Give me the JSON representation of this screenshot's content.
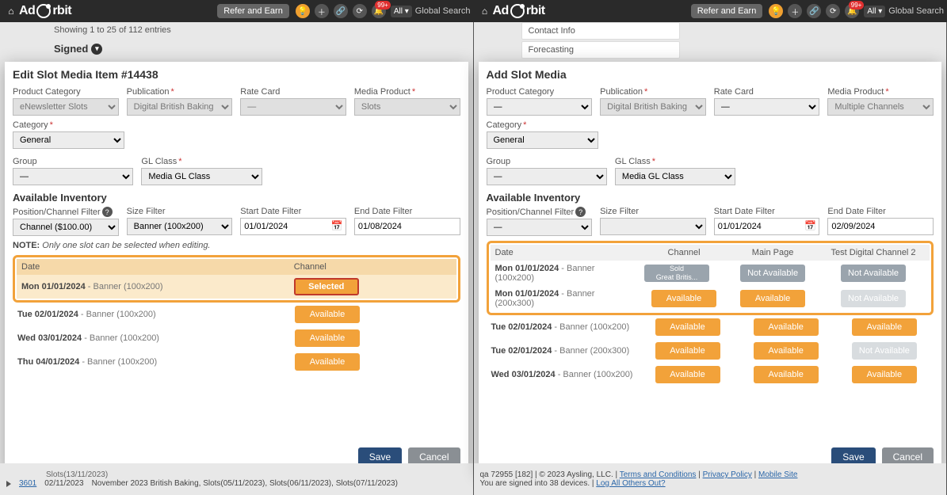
{
  "topbar": {
    "brand1": "Ad",
    "brand2": "rbit",
    "refer": "Refer and Earn",
    "notif": "99+",
    "all": "All",
    "global_search": "Global Search"
  },
  "left": {
    "bg_entries": "Showing 1 to 25 of 112 entries",
    "signed_heading": "Signed",
    "modal_title": "Edit Slot Media Item #14438",
    "labels": {
      "product_category": "Product Category",
      "publication": "Publication",
      "rate_card": "Rate Card",
      "media_product": "Media Product",
      "category": "Category",
      "group": "Group",
      "gl_class": "GL Class",
      "available_inventory": "Available Inventory",
      "pos_filter": "Position/Channel Filter",
      "size_filter": "Size Filter",
      "start_filter": "Start Date Filter",
      "end_filter": "End Date Filter"
    },
    "values": {
      "product_category": "eNewsletter Slots",
      "publication": "Digital British Baking",
      "rate_card": "—",
      "media_product": "Slots",
      "category": "General",
      "group": "—",
      "gl_class": "Media GL Class",
      "pos_filter": "Channel ($100.00)",
      "size_filter": "Banner (100x200)",
      "start_filter": "01/01/2024",
      "end_filter": "01/08/2024"
    },
    "note_bold": "NOTE:",
    "note_italic": "Only one slot can be selected when editing.",
    "table": {
      "col_date": "Date",
      "col_channel": "Channel",
      "rows": [
        {
          "date_bold": "Mon 01/01/2024",
          "size": " - Banner (100x200)",
          "status": "Selected",
          "kind": "selected"
        },
        {
          "date_bold": "Tue 02/01/2024",
          "size": " - Banner (100x200)",
          "status": "Available",
          "kind": "available"
        },
        {
          "date_bold": "Wed 03/01/2024",
          "size": " - Banner (100x200)",
          "status": "Available",
          "kind": "available"
        },
        {
          "date_bold": "Thu 04/01/2024",
          "size": " - Banner (100x200)",
          "status": "Available",
          "kind": "available"
        }
      ]
    },
    "save": "Save",
    "cancel": "Cancel",
    "bottom_row": {
      "id": "3601",
      "date": "02/11/2023",
      "desc1": "Slots(13/11/2023)",
      "desc2": "November 2023 British Baking, Slots(05/11/2023), Slots(06/11/2023), Slots(07/11/2023)"
    }
  },
  "right": {
    "sidebar": {
      "contact": "Contact Info",
      "forecasting": "Forecasting"
    },
    "modal_title": "Add Slot Media",
    "labels": {
      "product_category": "Product Category",
      "publication": "Publication",
      "rate_card": "Rate Card",
      "media_product": "Media Product",
      "category": "Category",
      "group": "Group",
      "gl_class": "GL Class",
      "available_inventory": "Available Inventory",
      "pos_filter": "Position/Channel Filter",
      "size_filter": "Size Filter",
      "start_filter": "Start Date Filter",
      "end_filter": "End Date Filter"
    },
    "values": {
      "product_category": "—",
      "publication": "Digital British Baking",
      "rate_card": "—",
      "media_product": "Multiple Channels",
      "category": "General",
      "group": "—",
      "gl_class": "Media GL Class",
      "pos_filter": "—",
      "size_filter": "",
      "start_filter": "01/01/2024",
      "end_filter": "02/09/2024"
    },
    "table": {
      "col_date": "Date",
      "col_channel": "Channel",
      "col_main": "Main Page",
      "col_test": "Test Digital Channel 2",
      "rows": [
        {
          "date_bold": "Mon 01/01/2024",
          "size": " - Banner (100x200)",
          "c1": {
            "k": "sold",
            "l1": "Sold",
            "l2": "Great Britis..."
          },
          "c2": {
            "k": "na",
            "l": "Not Available"
          },
          "c3": {
            "k": "na",
            "l": "Not Available"
          }
        },
        {
          "date_bold": "Mon 01/01/2024",
          "size": " - Banner (200x300)",
          "c1": {
            "k": "available",
            "l": "Available"
          },
          "c2": {
            "k": "available",
            "l": "Available"
          },
          "c3": {
            "k": "na-light",
            "l": "Not Available"
          }
        },
        {
          "date_bold": "Tue 02/01/2024",
          "size": " - Banner (100x200)",
          "c1": {
            "k": "available",
            "l": "Available"
          },
          "c2": {
            "k": "available",
            "l": "Available"
          },
          "c3": {
            "k": "available",
            "l": "Available"
          }
        },
        {
          "date_bold": "Tue 02/01/2024",
          "size": " - Banner (200x300)",
          "c1": {
            "k": "available",
            "l": "Available"
          },
          "c2": {
            "k": "available",
            "l": "Available"
          },
          "c3": {
            "k": "na-light",
            "l": "Not Available"
          }
        },
        {
          "date_bold": "Wed 03/01/2024",
          "size": " - Banner (100x200)",
          "c1": {
            "k": "available",
            "l": "Available"
          },
          "c2": {
            "k": "available",
            "l": "Available"
          },
          "c3": {
            "k": "available",
            "l": "Available"
          }
        }
      ]
    },
    "save": "Save",
    "cancel": "Cancel",
    "footer": {
      "line1a": "qa 72955 [182] | © 2023 Aysling, LLC. | ",
      "tnc": "Terms and Conditions",
      "sep1": " | ",
      "pp": "Privacy Policy",
      "sep2": " | ",
      "ms": "Mobile Site",
      "line2a": "You are signed into 38 devices. | ",
      "logout": "Log All Others Out?"
    }
  }
}
